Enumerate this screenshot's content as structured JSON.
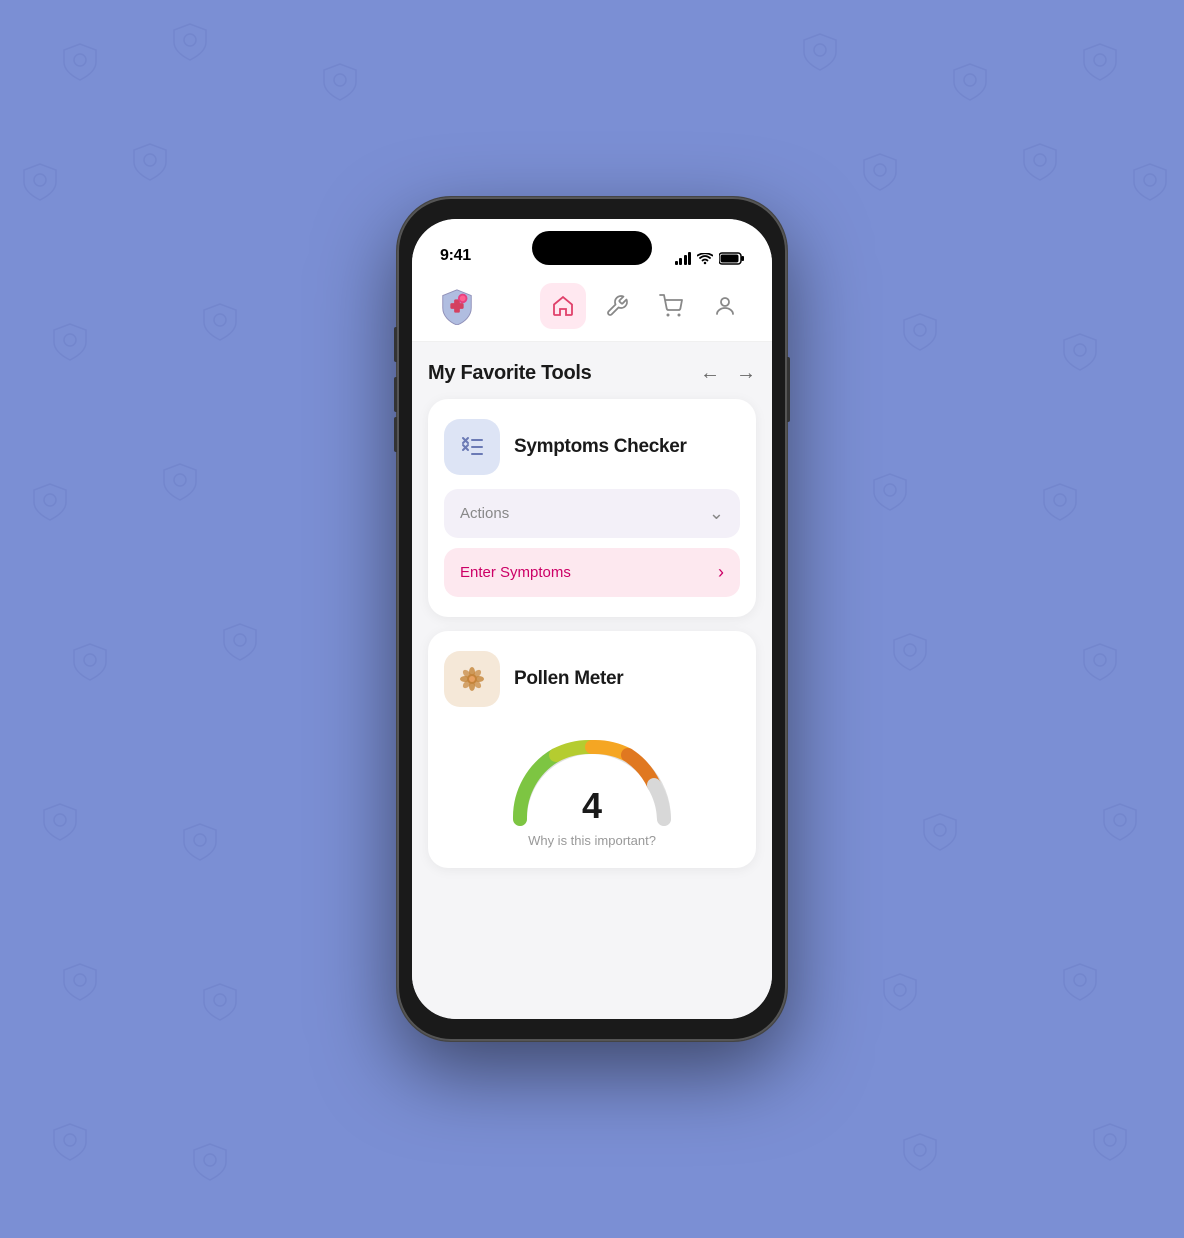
{
  "background": {
    "color": "#7b8fd4"
  },
  "status_bar": {
    "time": "9:41",
    "signal_label": "signal",
    "wifi_label": "wifi",
    "battery_label": "battery"
  },
  "nav": {
    "logo_alt": "app logo",
    "items": [
      {
        "id": "home",
        "label": "Home",
        "active": true
      },
      {
        "id": "tools",
        "label": "Tools",
        "active": false
      },
      {
        "id": "cart",
        "label": "Cart",
        "active": false
      },
      {
        "id": "profile",
        "label": "Profile",
        "active": false
      }
    ]
  },
  "section": {
    "title": "My Favorite Tools",
    "prev_arrow": "←",
    "next_arrow": "→"
  },
  "tools": [
    {
      "id": "symptoms-checker",
      "title": "Symptoms Checker",
      "icon_type": "checklist",
      "actions_label": "Actions",
      "enter_label": "Enter Symptoms"
    },
    {
      "id": "pollen-meter",
      "title": "Pollen Meter",
      "icon_type": "flower",
      "gauge_value": "4",
      "why_text": "Why is this important?"
    }
  ]
}
